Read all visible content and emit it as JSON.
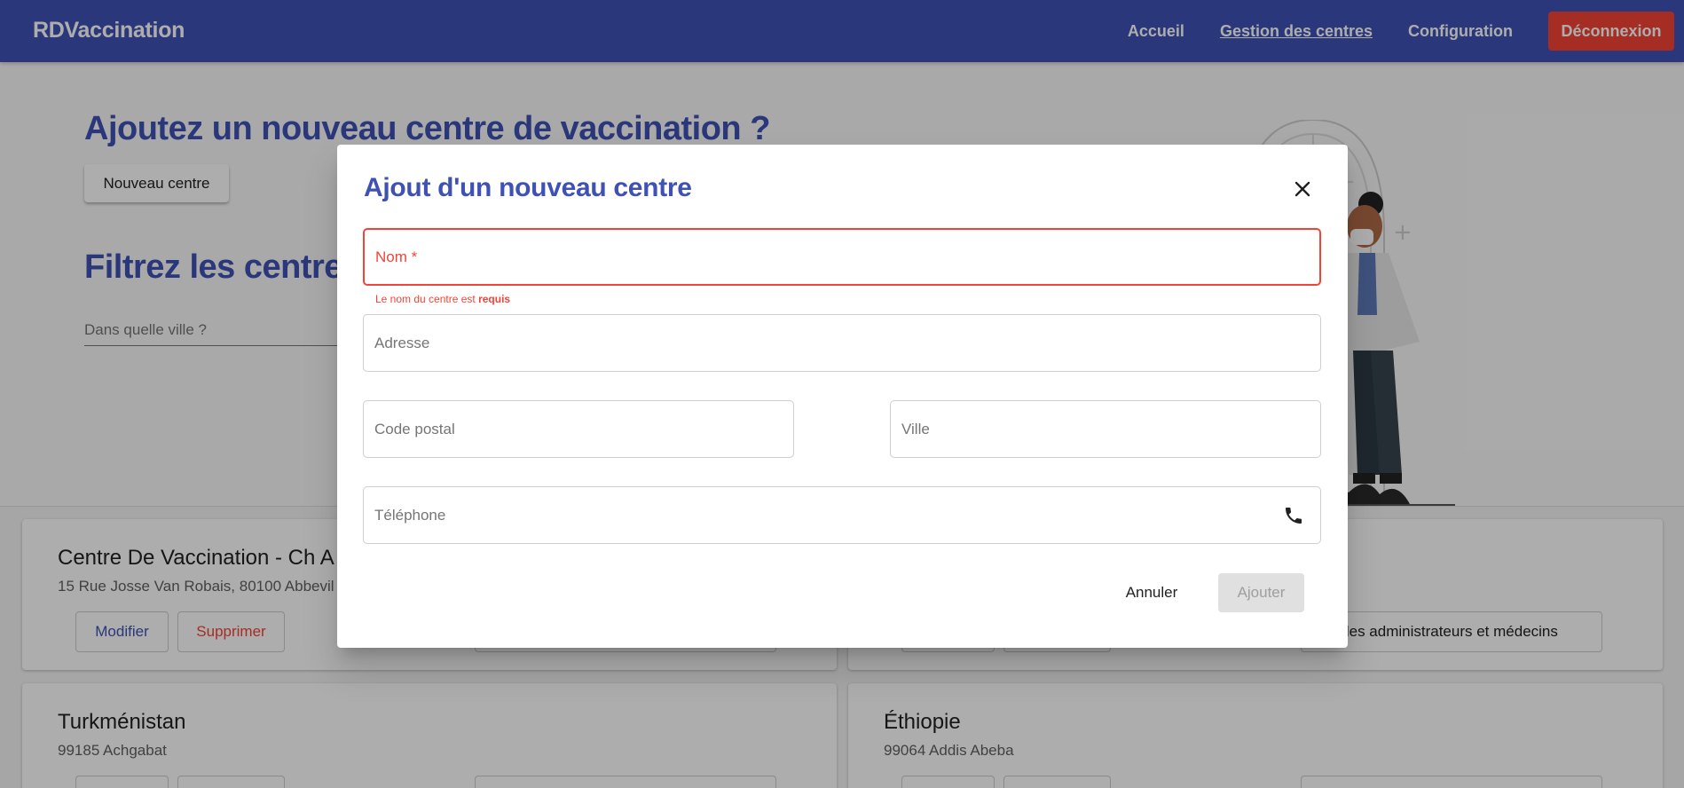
{
  "navbar": {
    "brand": "RDVaccination",
    "links": [
      "Accueil",
      "Gestion des centres",
      "Configuration"
    ],
    "logout": "Déconnexion",
    "color": "#3f51b5",
    "logout_color": "#f44336"
  },
  "page": {
    "add_heading": "Ajoutez un nouveau centre de vaccination ?",
    "new_center_button": "Nouveau centre",
    "filter_heading": "Filtrez les centres",
    "city_placeholder": "Dans quelle ville ?"
  },
  "cards": [
    {
      "title": "Centre De Vaccination - Ch A",
      "subtitle": "15 Rue Josse Van Robais, 80100 Abbevil",
      "edit": "Modifier",
      "delete": "Supprimer",
      "manage": "er les administrateurs et médecins"
    },
    {
      "title": "Turkménistan",
      "subtitle": "99185 Achgabat"
    },
    {
      "title": "Éthiopie",
      "subtitle": "99064 Addis Abeba"
    }
  ],
  "dialog": {
    "title": "Ajout d'un nouveau centre",
    "fields": {
      "name": "Nom *",
      "address": "Adresse",
      "postal_code": "Code postal",
      "city": "Ville",
      "phone": "Téléphone"
    },
    "error_prefix": "Le nom du centre est",
    "error_bold": "requis",
    "cancel": "Annuler",
    "submit": "Ajouter",
    "accent_color": "#3f51b5",
    "error_color": "#f44336"
  }
}
